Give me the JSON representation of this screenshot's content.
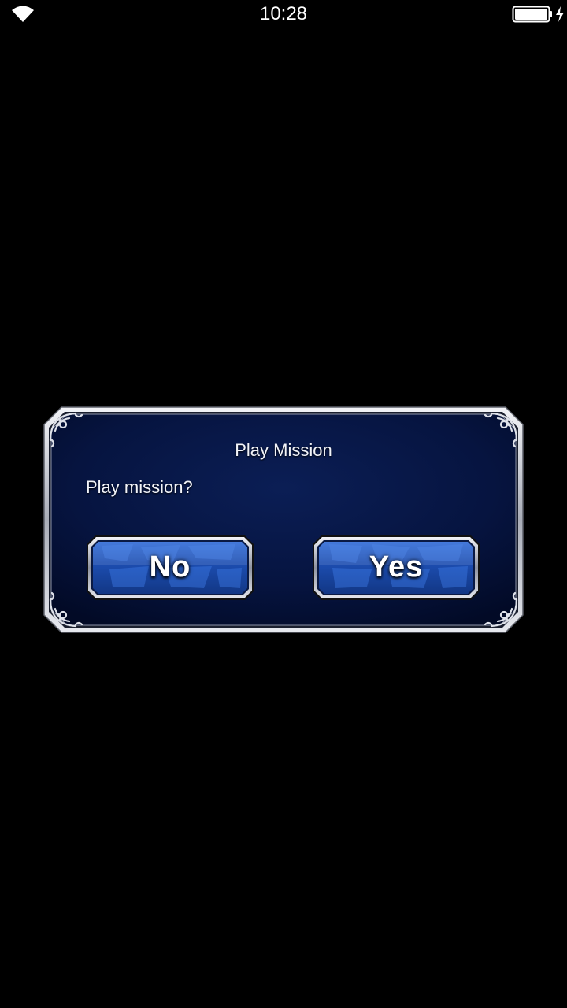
{
  "status_bar": {
    "time": "10:28",
    "icons": [
      "wifi-icon",
      "battery-icon",
      "charging-bolt-icon"
    ]
  },
  "dialog": {
    "title": "Play Mission",
    "message": "Play mission?",
    "buttons": {
      "no_label": "No",
      "yes_label": "Yes"
    }
  },
  "colors": {
    "background": "#000000",
    "dialog_fill": "#06123a",
    "frame_silver": "#c9ccd6",
    "button_blue": "#1e4fb0"
  }
}
